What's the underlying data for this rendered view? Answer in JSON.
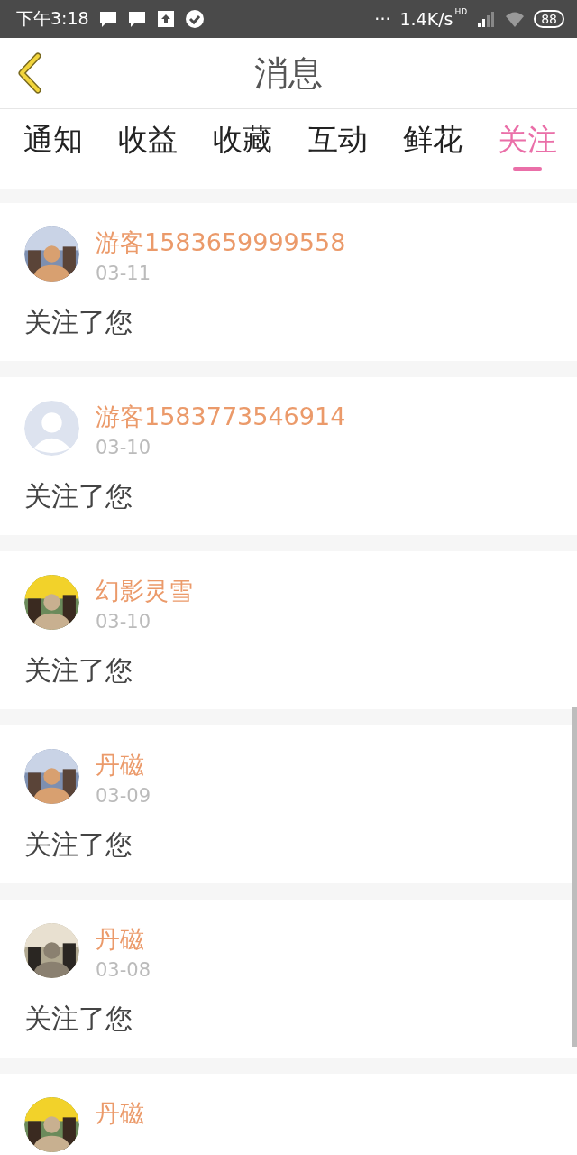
{
  "status_bar": {
    "time": "下午3:18",
    "more": "···",
    "speed": "1.4K/s",
    "network": "HD",
    "battery": "88"
  },
  "header": {
    "title": "消息"
  },
  "tabs": [
    {
      "label": "通知",
      "selected": false
    },
    {
      "label": "收益",
      "selected": false
    },
    {
      "label": "收藏",
      "selected": false
    },
    {
      "label": "互动",
      "selected": false
    },
    {
      "label": "鲜花",
      "selected": false
    },
    {
      "label": "关注",
      "selected": true
    }
  ],
  "messages": [
    {
      "name": "游客1583659999558",
      "date": "03-11",
      "text": "关注了您"
    },
    {
      "avatar": {
        "kind": "default"
      },
      "name": "游客1583773546914",
      "date": "03-10",
      "text": "关注了您"
    },
    {
      "name": "幻影灵雪",
      "date": "03-10",
      "text": "关注了您"
    },
    {
      "name": "丹磁",
      "date": "03-09",
      "text": "关注了您"
    },
    {
      "name": "丹磁",
      "date": "03-08",
      "text": "关注了您"
    },
    {
      "name": "丹磁"
    }
  ]
}
